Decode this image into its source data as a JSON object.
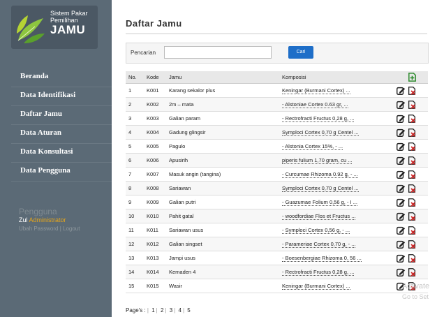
{
  "logo": {
    "line1": "Sistem Pakar",
    "line2": "Pemilihan",
    "line3": "JAMU"
  },
  "nav": [
    {
      "label": "Beranda"
    },
    {
      "label": "Data Identifikasi"
    },
    {
      "label": "Daftar Jamu"
    },
    {
      "label": "Data Aturan"
    },
    {
      "label": "Data Konsultasi"
    },
    {
      "label": "Data Pengguna"
    }
  ],
  "user": {
    "title": "Pengguna",
    "prefix": "Zul",
    "name": "Administrator",
    "links": "Ubah Password | Logout"
  },
  "page": {
    "title": "Daftar Jamu"
  },
  "search": {
    "label": "Pencarian",
    "value": "",
    "placeholder": "",
    "button": "Cari"
  },
  "table": {
    "headers": {
      "no": "No.",
      "kode": "Kode",
      "jamu": "Jamu",
      "komposisi": "Komposisi"
    },
    "rows": [
      {
        "no": "1",
        "kode": "K001",
        "jamu": "Karang sekalor plus",
        "komposisi": "Keningar (Burmani Cortex) ..."
      },
      {
        "no": "2",
        "kode": "K002",
        "jamu": "2m – mata",
        "komposisi": "- Alstoniae Cortex 0.63 gr, ..."
      },
      {
        "no": "3",
        "kode": "K003",
        "jamu": "Galian param",
        "komposisi": "- Rectrofracti Fructus 0,28 g, ..."
      },
      {
        "no": "4",
        "kode": "K004",
        "jamu": "Gadung glingsir",
        "komposisi": "Symploci Cortex 0,70 g Centel ..."
      },
      {
        "no": "5",
        "kode": "K005",
        "jamu": "Pagulo",
        "komposisi": "- Alstonia Cortex 15%, - ..."
      },
      {
        "no": "6",
        "kode": "K006",
        "jamu": "Apusirih",
        "komposisi": "piperis fulium 1,70 gram, cu ..."
      },
      {
        "no": "7",
        "kode": "K007",
        "jamu": "Masuk angin (tangina)",
        "komposisi": "- Curcumae Rhizoma 0.92 g, - ..."
      },
      {
        "no": "8",
        "kode": "K008",
        "jamu": "Sariawan",
        "komposisi": "Symploci Cortex 0,70 g Centel ..."
      },
      {
        "no": "9",
        "kode": "K009",
        "jamu": "Galian putri",
        "komposisi": "- Guazumae Folium 0,56 g, - I ..."
      },
      {
        "no": "10",
        "kode": "K010",
        "jamu": "Pahit gatal",
        "komposisi": "- woodfordiae Flos et Fructus ..."
      },
      {
        "no": "11",
        "kode": "K011",
        "jamu": "Sariawan usus",
        "komposisi": "- Symploci Cortex 0,56 g, - ..."
      },
      {
        "no": "12",
        "kode": "K012",
        "jamu": "Galian singset",
        "komposisi": "- Parameriae Cortex 0,70 g, - ..."
      },
      {
        "no": "13",
        "kode": "K013",
        "jamu": "Jampi usus",
        "komposisi": "- Boesenbergiae Rhizoma 0, 56 ..."
      },
      {
        "no": "14",
        "kode": "K014",
        "jamu": "Kemaden 4",
        "komposisi": "- Rectrofracti Fructus 0,28 g, ..."
      },
      {
        "no": "15",
        "kode": "K015",
        "jamu": "Wasir",
        "komposisi": "Keningar (Burmani Cortex) ..."
      }
    ]
  },
  "pagination": {
    "label": "Page's :",
    "pages": [
      "1",
      "2",
      "3",
      "4",
      "5"
    ]
  },
  "watermark": {
    "line1": "Activate",
    "line2": "Go to Set"
  },
  "colors": {
    "sidebar": "#5b6a76",
    "accent": "#1e6ec8",
    "delete": "#cc2222",
    "user_accent": "#e5a51b"
  }
}
